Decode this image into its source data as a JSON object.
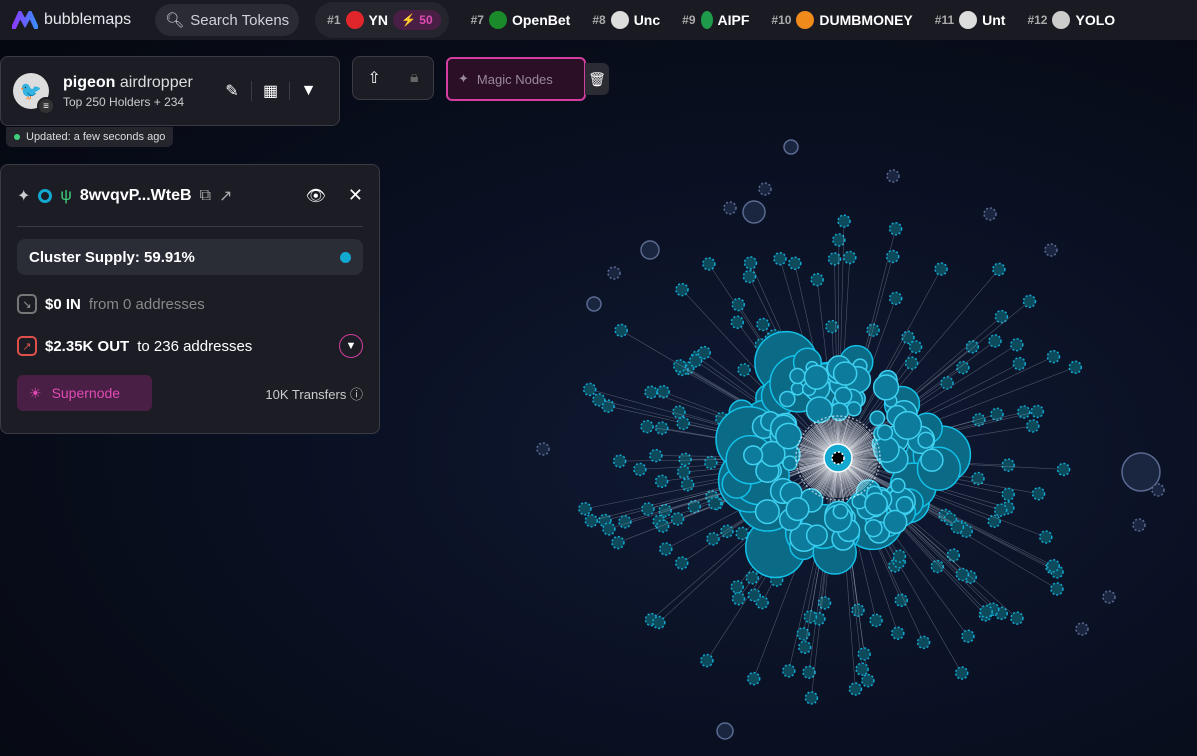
{
  "brand": "bubblemaps",
  "search": {
    "placeholder": "Search Tokens"
  },
  "trending": [
    {
      "rank": "#1",
      "name": "YN",
      "boost": "50",
      "color": "#e0262a"
    },
    {
      "rank": "#7",
      "name": "OpenBet",
      "color": "#1a8a2a"
    },
    {
      "rank": "#8",
      "name": "Unc",
      "color": "#dddddd"
    },
    {
      "rank": "#9",
      "name": "AIPF",
      "color": "#1e9a4a"
    },
    {
      "rank": "#10",
      "name": "DUMBMONEY",
      "color": "#f08a1a"
    },
    {
      "rank": "#11",
      "name": "Unt",
      "color": "#dddddd"
    },
    {
      "rank": "#12",
      "name": "YOLO",
      "color": "#cccccc"
    }
  ],
  "token": {
    "name": "pigeon",
    "subtitle": "airdropper",
    "holders": "Top 250 Holders + 234",
    "updated": "Updated: a few seconds ago"
  },
  "magic": {
    "label": "Magic Nodes"
  },
  "detail": {
    "address": "8wvqvP...WteB",
    "cluster_supply": "Cluster Supply: 59.91%",
    "in_amount": "$0 IN",
    "in_desc": "from 0 addresses",
    "out_amount": "$2.35K OUT",
    "out_desc": "to 236 addresses",
    "supernode": "Supernode",
    "transfers": "10K Transfers"
  },
  "colors": {
    "accent": "#d43ea0",
    "node": "#13a8d0"
  }
}
